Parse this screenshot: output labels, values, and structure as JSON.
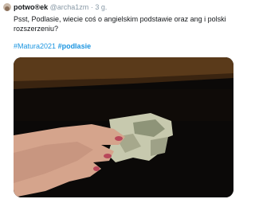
{
  "tweet": {
    "author": "potwo®ek",
    "handle": "@archa1zm",
    "separator": "·",
    "time": "3 g.",
    "text": "Psst, Podlasie, wiecie coś o angielskim podstawie oraz ang i polski rozszerzeniu?",
    "hashtag_1": "#Matura2021",
    "hashtag_2": "#podlasie"
  },
  "media": {
    "description": "photo-hand-with-dollar-bill"
  }
}
